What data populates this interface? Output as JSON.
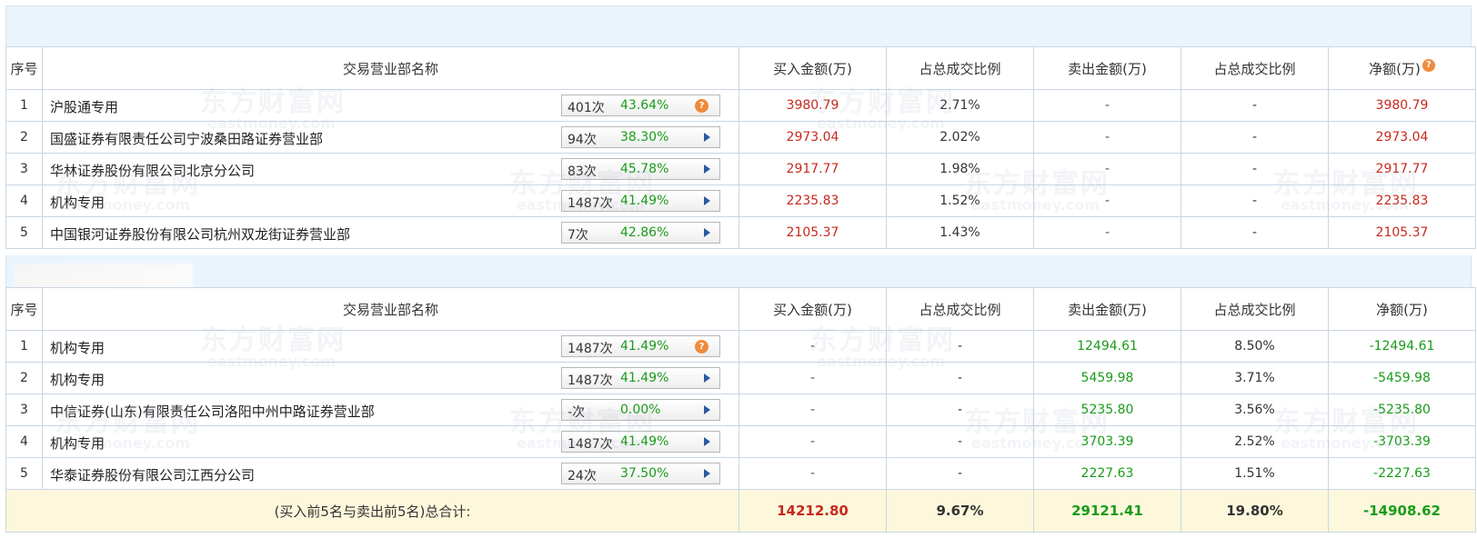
{
  "headers": {
    "idx": "序号",
    "name": "交易营业部名称",
    "buy": "买入金额(万)",
    "buy_ratio": "占总成交比例",
    "sell": "卖出金额(万)",
    "sell_ratio": "占总成交比例",
    "net": "净额(万)"
  },
  "help_glyph": "?",
  "watermark": {
    "cn": "东方财富网",
    "en": "eastmoney.com"
  },
  "buy_table": [
    {
      "idx": "1",
      "name": "沪股通专用",
      "count": "401次",
      "pct": "43.64%",
      "buy": "3980.79",
      "buy_ratio": "2.71%",
      "sell": "-",
      "sell_ratio": "-",
      "net": "3980.79",
      "icon": "help-icon"
    },
    {
      "idx": "2",
      "name": "国盛证券有限责任公司宁波桑田路证券营业部",
      "count": "94次",
      "pct": "38.30%",
      "buy": "2973.04",
      "buy_ratio": "2.02%",
      "sell": "-",
      "sell_ratio": "-",
      "net": "2973.04",
      "icon": "arrow-right-icon"
    },
    {
      "idx": "3",
      "name": "华林证券股份有限公司北京分公司",
      "count": "83次",
      "pct": "45.78%",
      "buy": "2917.77",
      "buy_ratio": "1.98%",
      "sell": "-",
      "sell_ratio": "-",
      "net": "2917.77",
      "icon": "arrow-right-icon"
    },
    {
      "idx": "4",
      "name": "机构专用",
      "count": "1487次",
      "pct": "41.49%",
      "buy": "2235.83",
      "buy_ratio": "1.52%",
      "sell": "-",
      "sell_ratio": "-",
      "net": "2235.83",
      "icon": "arrow-right-icon"
    },
    {
      "idx": "5",
      "name": "中国银河证券股份有限公司杭州双龙街证券营业部",
      "count": "7次",
      "pct": "42.86%",
      "buy": "2105.37",
      "buy_ratio": "1.43%",
      "sell": "-",
      "sell_ratio": "-",
      "net": "2105.37",
      "icon": "arrow-right-icon"
    }
  ],
  "sell_table": [
    {
      "idx": "1",
      "name": "机构专用",
      "count": "1487次",
      "pct": "41.49%",
      "buy": "-",
      "buy_ratio": "-",
      "sell": "12494.61",
      "sell_ratio": "8.50%",
      "net": "-12494.61",
      "icon": "help-icon"
    },
    {
      "idx": "2",
      "name": "机构专用",
      "count": "1487次",
      "pct": "41.49%",
      "buy": "-",
      "buy_ratio": "-",
      "sell": "5459.98",
      "sell_ratio": "3.71%",
      "net": "-5459.98",
      "icon": "arrow-right-icon"
    },
    {
      "idx": "3",
      "name": "中信证券(山东)有限责任公司洛阳中州中路证券营业部",
      "count": "-次",
      "pct": "0.00%",
      "buy": "-",
      "buy_ratio": "-",
      "sell": "5235.80",
      "sell_ratio": "3.56%",
      "net": "-5235.80",
      "icon": "arrow-right-icon"
    },
    {
      "idx": "4",
      "name": "机构专用",
      "count": "1487次",
      "pct": "41.49%",
      "buy": "-",
      "buy_ratio": "-",
      "sell": "3703.39",
      "sell_ratio": "2.52%",
      "net": "-3703.39",
      "icon": "arrow-right-icon"
    },
    {
      "idx": "5",
      "name": "华泰证券股份有限公司江西分公司",
      "count": "24次",
      "pct": "37.50%",
      "buy": "-",
      "buy_ratio": "-",
      "sell": "2227.63",
      "sell_ratio": "1.51%",
      "net": "-2227.63",
      "icon": "arrow-right-icon"
    }
  ],
  "total": {
    "label": "(买入前5名与卖出前5名)总合计:",
    "buy": "14212.80",
    "buy_ratio": "9.67%",
    "sell": "29121.41",
    "sell_ratio": "19.80%",
    "net": "-14908.62"
  },
  "colors": {
    "buy_value": "#c6291e",
    "sell_value": "#1a9b1a",
    "header_band": "#eaf4fc",
    "total_band": "#fdf8dc"
  }
}
